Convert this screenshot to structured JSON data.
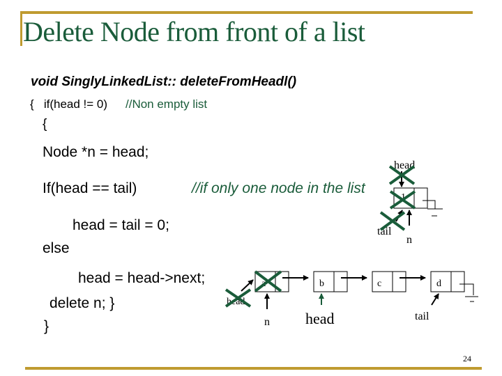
{
  "slide": {
    "title": "Delete Node from front of a list",
    "page_number": "24",
    "colors": {
      "accent_rule": "#bf9b30",
      "title": "#1a5c3a",
      "comment": "#1a5c3a",
      "cross": "#1a5c3a"
    }
  },
  "code": {
    "signature": "void SinglyLinkedList:: deleteFromHeadl()",
    "line1": "{   if(head != 0)",
    "line1_comment": "//Non empty list",
    "line2": "{",
    "line3": "Node *n = head;",
    "line4": "If(head == tail)",
    "line4_comment": "//if only one node in the list",
    "line5": "head = tail = 0;",
    "line6": "else",
    "line7": "head = head->next;",
    "line8": "delete n; }",
    "line9": "}"
  },
  "diagram_single": {
    "node_value": "1",
    "labels": {
      "head": "head",
      "tail": "tail",
      "n": "n"
    },
    "crossed_out": [
      "head",
      "node",
      "tail"
    ]
  },
  "diagram_multi": {
    "nodes": [
      "a",
      "b",
      "c",
      "d"
    ],
    "labels": {
      "old_head": "head",
      "n": "n",
      "new_head": "head",
      "tail": "tail"
    },
    "crossed_out": [
      "old_head",
      "node_a"
    ]
  }
}
